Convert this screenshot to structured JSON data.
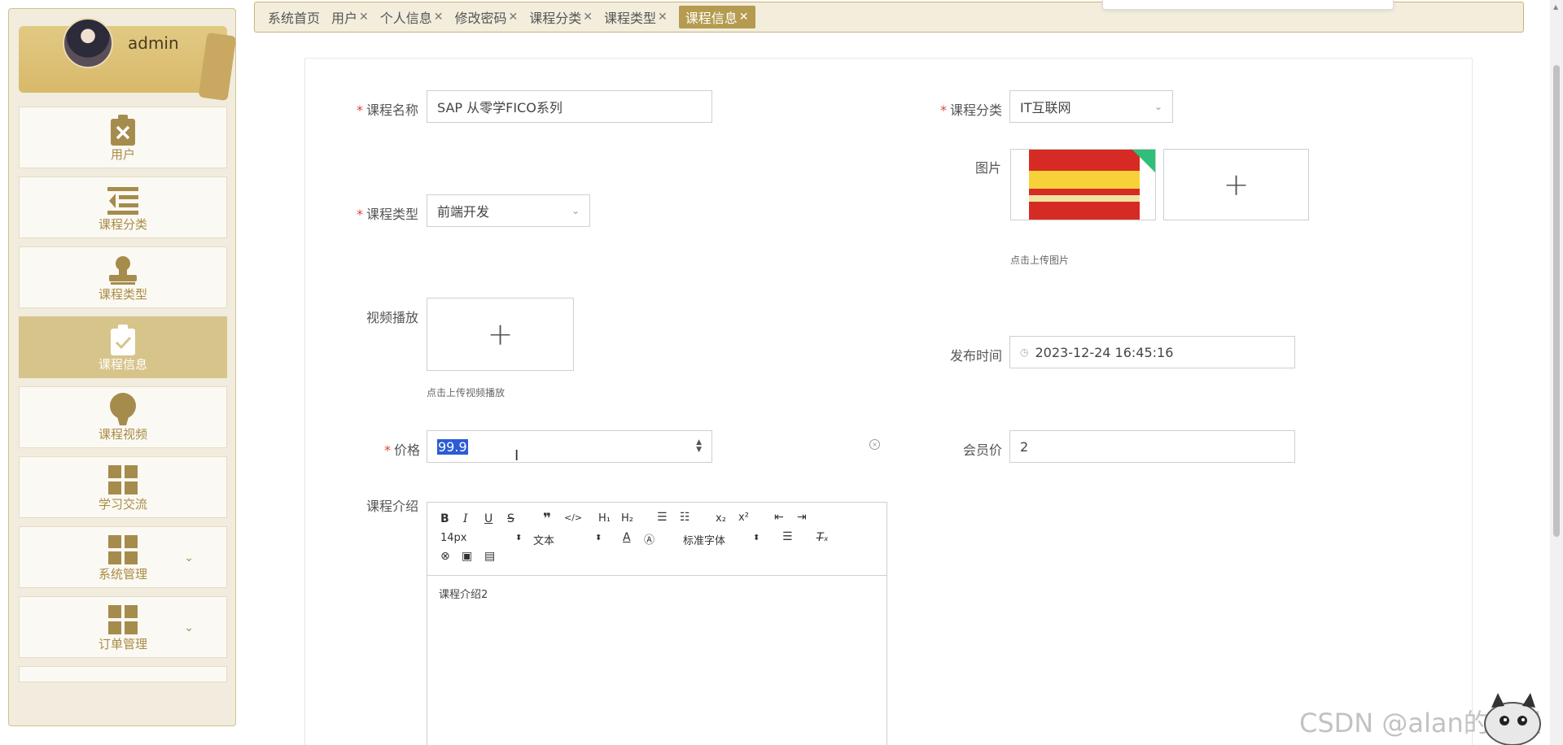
{
  "sidebar": {
    "user": {
      "name": "admin"
    },
    "items": [
      {
        "label": "用户",
        "icon": "clipboard-x-icon",
        "active": false
      },
      {
        "label": "课程分类",
        "icon": "list-indent-icon",
        "active": false
      },
      {
        "label": "课程类型",
        "icon": "stamp-icon",
        "active": false
      },
      {
        "label": "课程信息",
        "icon": "clipboard-check-icon",
        "active": true
      },
      {
        "label": "课程视频",
        "icon": "lightbulb-icon",
        "active": false
      },
      {
        "label": "学习交流",
        "icon": "grid-icon",
        "active": false
      },
      {
        "label": "系统管理",
        "icon": "grid-icon",
        "active": false,
        "expandable": true
      },
      {
        "label": "订单管理",
        "icon": "grid-icon",
        "active": false,
        "expandable": true
      }
    ]
  },
  "tabs": [
    {
      "label": "系统首页",
      "closable": false,
      "active": false
    },
    {
      "label": "用户",
      "closable": true,
      "active": false
    },
    {
      "label": "个人信息",
      "closable": true,
      "active": false
    },
    {
      "label": "修改密码",
      "closable": true,
      "active": false
    },
    {
      "label": "课程分类",
      "closable": true,
      "active": false
    },
    {
      "label": "课程类型",
      "closable": true,
      "active": false
    },
    {
      "label": "课程信息",
      "closable": true,
      "active": true
    }
  ],
  "form": {
    "course_name": {
      "label": "课程名称",
      "value": "SAP 从零学FICO系列",
      "required": true
    },
    "course_category": {
      "label": "课程分类",
      "value": "IT互联网",
      "required": true
    },
    "image": {
      "label": "图片",
      "hint": "点击上传图片"
    },
    "course_type": {
      "label": "课程类型",
      "value": "前端开发",
      "required": true
    },
    "video": {
      "label": "视频播放",
      "hint": "点击上传视频播放"
    },
    "publish_time": {
      "label": "发布时间",
      "value": "2023-12-24 16:45:16"
    },
    "price": {
      "label": "价格",
      "value": "99.9",
      "required": true
    },
    "member_price": {
      "label": "会员价",
      "value": "2"
    },
    "intro": {
      "label": "课程介绍",
      "content": "课程介绍2",
      "font_size": "14px",
      "text_style": "文本",
      "font_family": "标准字体"
    }
  },
  "watermark": "CSDN @alan的小屋",
  "colors": {
    "accent": "#b59b4f",
    "sidebar_bg": "#f1ecdd",
    "active_item": "#d7c48b",
    "required": "#e3423f",
    "selection": "#2b5cd6"
  }
}
